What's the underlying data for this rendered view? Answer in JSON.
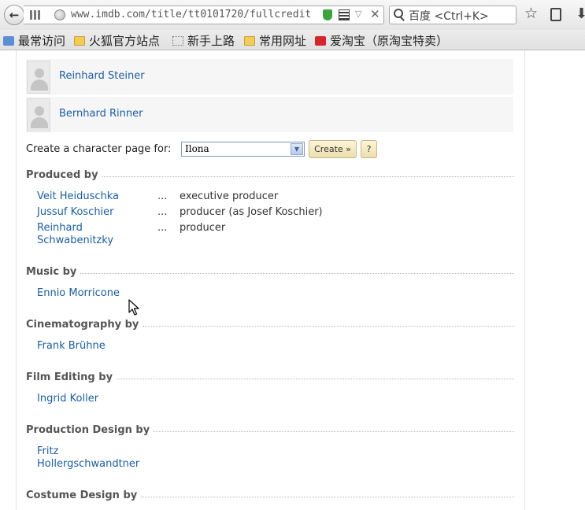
{
  "browser": {
    "url": "www.imdb.com/title/tt0101720/fullcredit",
    "search_placeholder": "百度 <Ctrl+K>",
    "bookmarks": [
      {
        "label": "最常访问",
        "icon": "bookmark-icon"
      },
      {
        "label": "火狐官方站点",
        "icon": "folder-icon"
      },
      {
        "label": "新手上路",
        "icon": "page-icon"
      },
      {
        "label": "常用网址",
        "icon": "folder-icon"
      },
      {
        "label": "爱淘宝（原淘宝特卖）",
        "icon": "taobao-icon"
      }
    ]
  },
  "cast": [
    {
      "name": "Reinhard Steiner"
    },
    {
      "name": "Bernhard Rinner"
    }
  ],
  "character_page": {
    "label": "Create a character page for:",
    "selected": "Ilona",
    "create_label": "Create »",
    "help_label": "?"
  },
  "sections": {
    "produced_by": {
      "heading": "Produced by",
      "credits": [
        {
          "name": "Veit Heiduschka",
          "dots": "...",
          "role": "executive producer"
        },
        {
          "name": "Jussuf Koschier",
          "dots": "...",
          "role": "producer (as Josef Koschier)"
        },
        {
          "name": "Reinhard Schwabenitzky",
          "dots": "...",
          "role": "producer"
        }
      ]
    },
    "music_by": {
      "heading": "Music by",
      "credits": [
        {
          "name": "Ennio Morricone"
        }
      ]
    },
    "cinematography_by": {
      "heading": "Cinematography by",
      "credits": [
        {
          "name": "Frank Brühne"
        }
      ]
    },
    "film_editing_by": {
      "heading": "Film Editing by",
      "credits": [
        {
          "name": "Ingrid Koller"
        }
      ]
    },
    "production_design_by": {
      "heading": "Production Design by",
      "credits": [
        {
          "name": "Fritz Hollergschwandtner"
        }
      ]
    },
    "costume_design_by": {
      "heading": "Costume Design by"
    }
  },
  "colors": {
    "link": "#1a5ea8",
    "heading": "#555555",
    "row_bg": "#f6f6f6"
  }
}
